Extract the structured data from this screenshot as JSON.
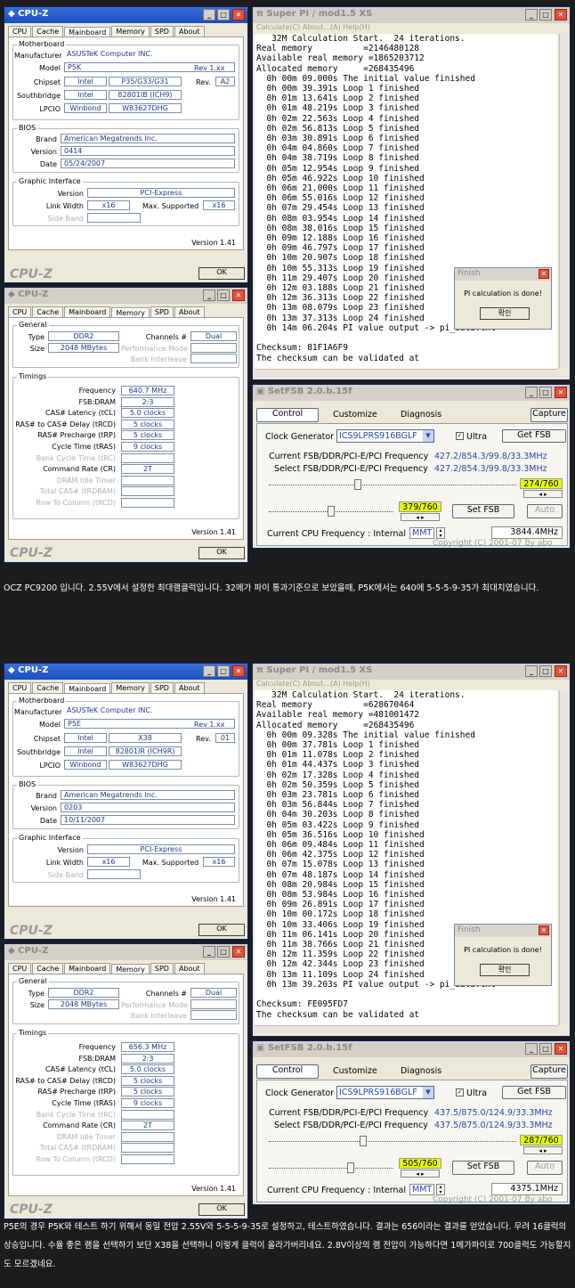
{
  "shots": [
    {
      "cpuz_main": {
        "title": "CPU-Z",
        "tabs": [
          "CPU",
          "Cache",
          "Mainboard",
          "Memory",
          "SPD",
          "About"
        ],
        "motherboard_label": "Motherboard",
        "manufacturer_label": "Manufacturer",
        "manufacturer": "ASUSTeK Computer INC.",
        "model_label": "Model",
        "model": "P5K",
        "model_rev": "Rev 1.xx",
        "chipset_label": "Chipset",
        "chipset_vendor": "Intel",
        "chipset": "P35/G33/G31",
        "rev_label": "Rev.",
        "rev": "A2",
        "southbridge_label": "Southbridge",
        "sb_vendor": "Intel",
        "southbridge": "82801IB (ICH9)",
        "lpcio_label": "LPCIO",
        "lpcio_vendor": "Winbond",
        "lpcio": "W83627DHG",
        "bios_label": "BIOS",
        "brand_label": "Brand",
        "brand": "American Megatrends Inc.",
        "version_label": "Version",
        "bios_version": "0414",
        "date_label": "Date",
        "date": "05/24/2007",
        "gi_label": "Graphic Interface",
        "gi_version_label": "Version",
        "gi_version": "PCI-Express",
        "link_label": "Link Width",
        "link": "x16",
        "max_label": "Max. Supported",
        "max": "x16",
        "side_label": "Side Band",
        "version_text": "Version 1.41",
        "logo": "CPU-Z",
        "ok": "OK"
      },
      "cpuz_mem": {
        "title": "CPU-Z",
        "tabs": [
          "CPU",
          "Cache",
          "Mainboard",
          "Memory",
          "SPD",
          "About"
        ],
        "general_label": "General",
        "type_label": "Type",
        "type": "DDR2",
        "channels_label": "Channels #",
        "channels": "Dual",
        "size_label": "Size",
        "size": "2048 MBytes",
        "perf_label": "Performance Mode",
        "bank_label": "Bank Interleave",
        "timings_label": "Timings",
        "rows": [
          {
            "label": "Frequency",
            "value": "640.7 MHz"
          },
          {
            "label": "FSB:DRAM",
            "value": "2:3"
          },
          {
            "label": "CAS# Latency (tCL)",
            "value": "5.0 clocks"
          },
          {
            "label": "RAS# to CAS# Delay (tRCD)",
            "value": "5 clocks"
          },
          {
            "label": "RAS# Precharge (tRP)",
            "value": "5 clocks"
          },
          {
            "label": "Cycle Time (tRAS)",
            "value": "9 clocks"
          },
          {
            "label": "Bank Cycle Time (tRC)",
            "value": ""
          },
          {
            "label": "Command Rate (CR)",
            "value": "2T"
          },
          {
            "label": "DRAM Idle Timer",
            "value": ""
          },
          {
            "label": "Total CAS# (tRDRAM)",
            "value": ""
          },
          {
            "label": "Row To Column (tRCD)",
            "value": ""
          }
        ],
        "version_text": "Version 1.41",
        "logo": "CPU-Z",
        "ok": "OK"
      },
      "superpi": {
        "title": "Super PI / mod1.5 XS",
        "menu": "Calculate(C)   About...(A)   Help(H)",
        "console": "   32M Calculation Start.  24 iterations.\nReal memory          =2146480128\nAvailable real memory =1865203712\nAllocated memory     =268435496\n  0h 00m 09.000s The initial value finished\n  0h 00m 39.391s Loop 1 finished\n  0h 01m 13.641s Loop 2 finished\n  0h 01m 48.219s Loop 3 finished\n  0h 02m 22.563s Loop 4 finished\n  0h 02m 56.813s Loop 5 finished\n  0h 03m 30.891s Loop 6 finished\n  0h 04m 04.860s Loop 7 finished\n  0h 04m 38.719s Loop 8 finished\n  0h 05m 12.954s Loop 9 finished\n  0h 05m 46.922s Loop 10 finished\n  0h 06m 21.000s Loop 11 finished\n  0h 06m 55.016s Loop 12 finished\n  0h 07m 29.454s Loop 13 finished\n  0h 08m 03.954s Loop 14 finished\n  0h 08m 38.016s Loop 15 finished\n  0h 09m 12.188s Loop 16 finished\n  0h 09m 46.797s Loop 17 finished\n  0h 10m 20.907s Loop 18 finished\n  0h 10m 55.313s Loop 19 finished\n  0h 11m 29.407s Loop 20 finished\n  0h 12m 03.188s Loop 21 finished\n  0h 12m 36.313s Loop 22 finished\n  0h 13m 08.079s Loop 23 finished\n  0h 13m 37.313s Loop 24 finished\n  0h 14m 06.204s PI value output -> pi_data.txt\n\nChecksum: 81F1A6F9\nThe checksum can be validated at",
        "finish_title": "Finish",
        "finish_msg": "PI calculation is done!",
        "finish_ok": "확인"
      },
      "setfsb": {
        "title": "SetFSB 2.0.b.15f",
        "tabs": [
          "Control",
          "Customize",
          "Diagnosis"
        ],
        "capture": "Capture",
        "clock_label": "Clock Generator",
        "clock": "ICS9LPRS916BGLF",
        "ultra": "Ultra",
        "get_fsb": "Get FSB",
        "cur_label": "Current FSB/DDR/PCI-E/PCI Frequency",
        "cur": "427.2/854.3/99.8/33.3MHz",
        "sel_label": "Select FSB/DDR/PCI-E/PCI Frequency",
        "sel": "427.2/854.3/99.8/33.3MHz",
        "slider1": "274/760",
        "slider2": "379/760",
        "set_fsb": "Set FSB",
        "auto": "Auto",
        "cpu_label": "Current CPU Frequency : Internal",
        "mmt": "MMT",
        "cpu": "3844.4MHz",
        "copyright": "Copyright (C) 2001-07 By abo",
        "slider1_frac": 0.36,
        "slider2_frac": 0.5
      },
      "caption": "OCZ PC9200 입니다. 2.55V에서 설정한 최대램클럭입니다. 32메가 파이 통과기준으로 보았을때, P5K에서는 640에 5-5-5-9-35가 최대치였습니다."
    },
    {
      "cpuz_main": {
        "title": "CPU-Z",
        "tabs": [
          "CPU",
          "Cache",
          "Mainboard",
          "Memory",
          "SPD",
          "About"
        ],
        "motherboard_label": "Motherboard",
        "manufacturer_label": "Manufacturer",
        "manufacturer": "ASUSTeK Computer INC.",
        "model_label": "Model",
        "model": "P5E",
        "model_rev": "Rev 1.xx",
        "chipset_label": "Chipset",
        "chipset_vendor": "Intel",
        "chipset": "X38",
        "rev_label": "Rev.",
        "rev": "01",
        "southbridge_label": "Southbridge",
        "sb_vendor": "Intel",
        "southbridge": "82801IR (ICH9R)",
        "lpcio_label": "LPCIO",
        "lpcio_vendor": "Winbond",
        "lpcio": "W83627DHG",
        "bios_label": "BIOS",
        "brand_label": "Brand",
        "brand": "American Megatrends Inc.",
        "version_label": "Version",
        "bios_version": "0203",
        "date_label": "Date",
        "date": "10/11/2007",
        "gi_label": "Graphic Interface",
        "gi_version_label": "Version",
        "gi_version": "PCI-Express",
        "link_label": "Link Width",
        "link": "x16",
        "max_label": "Max. Supported",
        "max": "x16",
        "side_label": "Side Band",
        "version_text": "Version 1.41",
        "logo": "CPU-Z",
        "ok": "OK"
      },
      "cpuz_mem": {
        "title": "CPU-Z",
        "tabs": [
          "CPU",
          "Cache",
          "Mainboard",
          "Memory",
          "SPD",
          "About"
        ],
        "general_label": "General",
        "type_label": "Type",
        "type": "DDR2",
        "channels_label": "Channels #",
        "channels": "Dual",
        "size_label": "Size",
        "size": "2048 MBytes",
        "perf_label": "Performance Mode",
        "bank_label": "Bank Interleave",
        "timings_label": "Timings",
        "rows": [
          {
            "label": "Frequency",
            "value": "656.3 MHz"
          },
          {
            "label": "FSB:DRAM",
            "value": "2:3"
          },
          {
            "label": "CAS# Latency (tCL)",
            "value": "5.0 clocks"
          },
          {
            "label": "RAS# to CAS# Delay (tRCD)",
            "value": "5 clocks"
          },
          {
            "label": "RAS# Precharge (tRP)",
            "value": "5 clocks"
          },
          {
            "label": "Cycle Time (tRAS)",
            "value": "9 clocks"
          },
          {
            "label": "Bank Cycle Time (tRC)",
            "value": ""
          },
          {
            "label": "Command Rate (CR)",
            "value": "2T"
          },
          {
            "label": "DRAM Idle Timer",
            "value": ""
          },
          {
            "label": "Total CAS# (tRDRAM)",
            "value": ""
          },
          {
            "label": "Row To Column (tRCD)",
            "value": ""
          }
        ],
        "version_text": "Version 1.41",
        "logo": "CPU-Z",
        "ok": "OK"
      },
      "superpi": {
        "title": "Super PI / mod1.5 XS",
        "menu": "Calculate(C)   About...(A)   Help(H)",
        "console": "   32M Calculation Start.  24 iterations.\nReal memory          =628670464\nAvailable real memory =481001472\nAllocated memory     =268435496\n  0h 00m 09.328s The initial value finished\n  0h 00m 37.781s Loop 1 finished\n  0h 01m 11.078s Loop 2 finished\n  0h 01m 44.437s Loop 3 finished\n  0h 02m 17.328s Loop 4 finished\n  0h 02m 50.359s Loop 5 finished\n  0h 03m 23.781s Loop 6 finished\n  0h 03m 56.844s Loop 7 finished\n  0h 04m 30.203s Loop 8 finished\n  0h 05m 03.422s Loop 9 finished\n  0h 05m 36.516s Loop 10 finished\n  0h 06m 09.484s Loop 11 finished\n  0h 06m 42.375s Loop 12 finished\n  0h 07m 15.078s Loop 13 finished\n  0h 07m 48.187s Loop 14 finished\n  0h 08m 20.984s Loop 15 finished\n  0h 08m 53.984s Loop 16 finished\n  0h 09m 26.891s Loop 17 finished\n  0h 10m 00.172s Loop 18 finished\n  0h 10m 33.406s Loop 19 finished\n  0h 11m 06.141s Loop 20 finished\n  0h 11m 38.766s Loop 21 finished\n  0h 12m 11.359s Loop 22 finished\n  0h 12m 42.344s Loop 23 finished\n  0h 13m 11.109s Loop 24 finished\n  0h 13m 39.203s PI value output -> pi_data.txt\n\nChecksum: FE095FD7\nThe checksum can be validated at",
        "finish_title": "Finish",
        "finish_msg": "PI calculation is done!",
        "finish_ok": "확인"
      },
      "setfsb": {
        "title": "SetFSB 2.0.b.15f",
        "tabs": [
          "Control",
          "Customize",
          "Diagnosis"
        ],
        "capture": "Capture",
        "clock_label": "Clock Generator",
        "clock": "ICS9LPRS916BGLF",
        "ultra": "Ultra",
        "get_fsb": "Get FSB",
        "cur_label": "Current FSB/DDR/PCI-E/PCI Frequency",
        "cur": "437.5/875.0/124.9/33.3MHz",
        "sel_label": "Select FSB/DDR/PCI-E/PCI Frequency",
        "sel": "437.5/875.0/124.9/33.3MHz",
        "slider1": "287/760",
        "slider2": "505/760",
        "set_fsb": "Set FSB",
        "auto": "Auto",
        "cpu_label": "Current CPU Frequency : Internal",
        "mmt": "MMT",
        "cpu": "4375.1MHz",
        "copyright": "Copyright (C) 2001-07 By abo",
        "slider1_frac": 0.38,
        "slider2_frac": 0.66
      },
      "caption": "P5E의 경우 P5K와 테스트 하기 위해서 동일 전압 2.55V와 5-5-5-9-35로 설정하고, 테스트하였습니다. 결과는 656이라는 결과를 얻었습니다. 무려 16클럭의 상승입니다. 수율 좋은 램을 선택하기 보단 X38을 선택하니 이렇게 클럭이 올라가버리네요. 2.8V이상의 램 전압이 가능하다면 1메가파이로 700클럭도 가능할지도 모르겠네요."
    }
  ]
}
